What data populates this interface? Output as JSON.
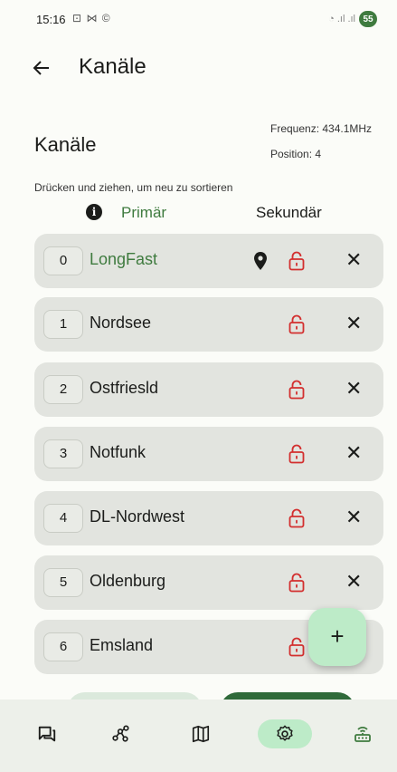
{
  "status_bar": {
    "time": "15:16",
    "left_icons": "⊡ ⋈ ©",
    "right_icons": "◔ .ıl .ıl",
    "battery": "55"
  },
  "app_bar": {
    "back_icon": "arrow-left-icon",
    "title": "Kanäle"
  },
  "header": {
    "section_title": "Kanäle",
    "frequency": "Frequenz: 434.1MHz",
    "position": "Position: 4",
    "hint": "Drücken und ziehen, um neu zu sortieren"
  },
  "tabs": {
    "primary": "Primär",
    "secondary": "Sekundär"
  },
  "channels": [
    {
      "index": "0",
      "name": "LongFast",
      "primary": true,
      "has_location": true
    },
    {
      "index": "1",
      "name": "Nordsee"
    },
    {
      "index": "2",
      "name": "Ostfriesld"
    },
    {
      "index": "3",
      "name": "Notfunk"
    },
    {
      "index": "4",
      "name": "DL-Nordwest"
    },
    {
      "index": "5",
      "name": "Oldenburg"
    },
    {
      "index": "6",
      "name": "Emsland"
    }
  ],
  "fab": {
    "label": "+"
  },
  "colors": {
    "accent_green": "#3f7b3f",
    "lock_red": "#d32f2f",
    "row_bg": "#e2e4df",
    "fab_bg": "#bdebc8"
  },
  "nav": [
    {
      "icon": "messages-icon",
      "active": false
    },
    {
      "icon": "nodes-icon",
      "active": false
    },
    {
      "icon": "map-icon",
      "active": false
    },
    {
      "icon": "settings-icon",
      "active": true
    },
    {
      "icon": "device-icon",
      "active": false
    }
  ]
}
